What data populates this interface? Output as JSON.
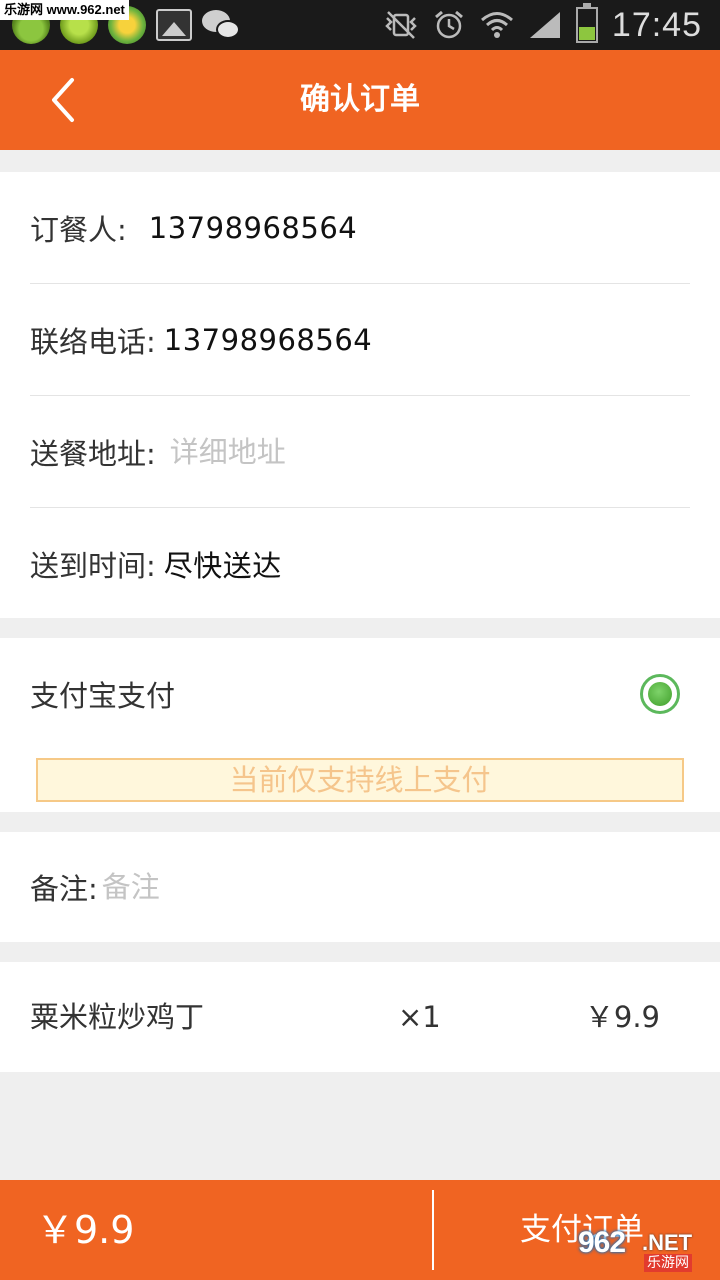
{
  "status_bar": {
    "watermark": "乐游网 www.962.net",
    "time": "17:45"
  },
  "header": {
    "title": "确认订单"
  },
  "order_info": {
    "orderer_label": "订餐人:",
    "orderer_value": "13798968564",
    "phone_label": "联络电话:",
    "phone_value": "13798968564",
    "address_label": "送餐地址:",
    "address_placeholder": "详细地址",
    "time_label": "送到时间:",
    "time_value": "尽快送达"
  },
  "payment": {
    "method_label": "支付宝支付",
    "selected": true,
    "notice": "当前仅支持线上支付"
  },
  "remark": {
    "label": "备注:",
    "placeholder": "备注"
  },
  "items": [
    {
      "name": "粟米粒炒鸡丁",
      "qty": "×1",
      "price": "￥9.9"
    }
  ],
  "footer": {
    "total": "￥9.9",
    "pay_button": "支付订单"
  },
  "site_watermark": {
    "number": "962",
    "domain": ".NET",
    "name": "乐游网"
  },
  "colors": {
    "brand": "#f06422",
    "radio": "#5cb85c",
    "notice_bg": "#fff7dc",
    "notice_text": "#f5c58c"
  }
}
